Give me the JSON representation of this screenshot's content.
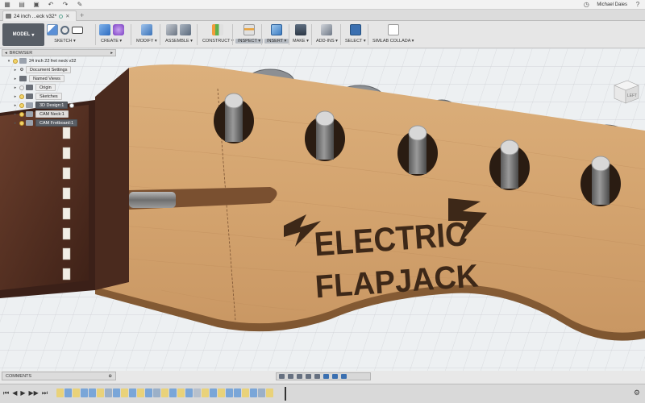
{
  "appbar": {
    "user": "Michael Daies",
    "icons": [
      "grid-icon",
      "file-icon",
      "save-icon",
      "undo-icon",
      "redo-icon",
      "extensions-icon",
      "clock-icon",
      "help-icon"
    ]
  },
  "tab": {
    "title": "24 inch ...eck v32*",
    "close": "✕",
    "add": "+"
  },
  "ribbon": {
    "workspace": "MODEL",
    "groups": [
      {
        "label": "SKETCH ▾"
      },
      {
        "label": "CREATE ▾"
      },
      {
        "label": "MODIFY ▾"
      },
      {
        "label": "ASSEMBLE ▾"
      },
      {
        "label": "CONSTRUCT ▾"
      },
      {
        "label": "INSPECT ▾"
      },
      {
        "label": "INSERT ▾"
      },
      {
        "label": "MAKE ▾"
      },
      {
        "label": "ADD-INS ▾"
      },
      {
        "label": "SELECT ▾"
      },
      {
        "label": "SIMLAB COLLADA ▾"
      }
    ]
  },
  "browser": {
    "title": "BROWSER",
    "root": "24 inch 22 fret neck v32",
    "items": [
      {
        "label": "Document Settings"
      },
      {
        "label": "Named Views"
      },
      {
        "label": "Origin"
      },
      {
        "label": "Sketches"
      },
      {
        "label": "3D Design:1"
      },
      {
        "label": "CAM Neck:1"
      },
      {
        "label": "CAM Fretboard:1"
      }
    ]
  },
  "model": {
    "logo_line1": "ELECTRIC",
    "logo_line2": "FLAPJACK"
  },
  "viewcube": {
    "label": "LEFT"
  },
  "comments": {
    "title": "COMMENTS"
  },
  "timeline": {
    "controls": [
      "⏮",
      "◀",
      "▶",
      "▶▶",
      "⏭"
    ],
    "settings": "⚙"
  },
  "colors": {
    "wood": "#d6a774",
    "fretboard": "#5a3426",
    "accent": "#3a8fd9",
    "ribbon_bg": "#e6e6e6"
  }
}
